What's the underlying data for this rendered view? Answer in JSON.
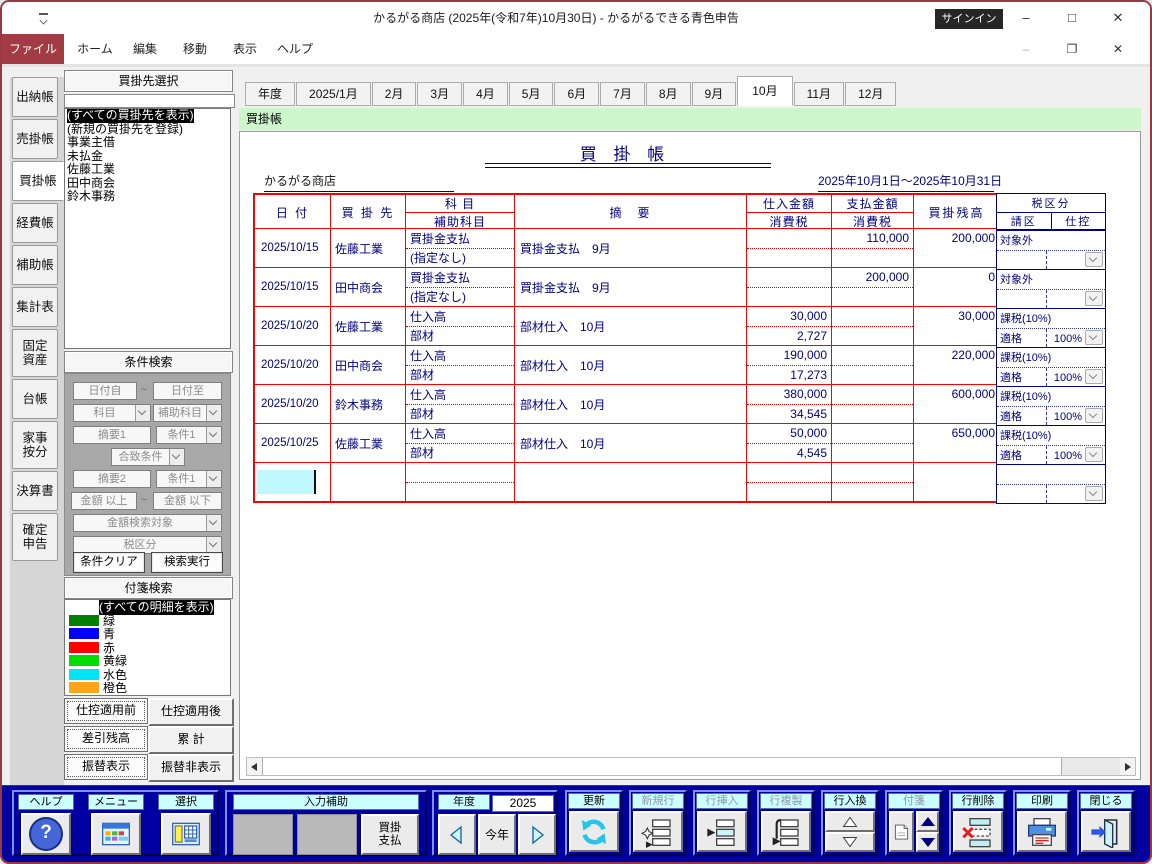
{
  "window": {
    "title": "かるがる商店 (2025年(令和7年)10月30日)  -  かるがるできる青色申告",
    "signin_label": "サインイン",
    "controls": {
      "minimize": "–",
      "maximize": "□",
      "close": "✕"
    },
    "mdi_controls": {
      "minimize": "–",
      "restore": "❐",
      "close": "✕"
    }
  },
  "menubar": {
    "items": [
      {
        "label": "ファイル",
        "selected": true
      },
      {
        "label": "ホーム"
      },
      {
        "label": "編集"
      },
      {
        "label": "移動"
      },
      {
        "label": "表示"
      },
      {
        "label": "ヘルプ"
      }
    ]
  },
  "sidebar": {
    "tabs": [
      {
        "label": "出納帳"
      },
      {
        "label": "売掛帳"
      },
      {
        "label": "買掛帳",
        "selected": true
      },
      {
        "label": "経費帳"
      },
      {
        "label": "補助帳"
      },
      {
        "label": "集計表"
      },
      {
        "label": "固定\n資産",
        "tall": true
      },
      {
        "label": "台帳"
      },
      {
        "label": "家事\n按分",
        "tall": true
      },
      {
        "label": "決算書"
      },
      {
        "label": "確定\n申告",
        "tall": true
      }
    ]
  },
  "partner_panel": {
    "header": "買掛先選択",
    "filter_value": "",
    "items": [
      {
        "label": "(すべての買掛先を表示)",
        "selected": true
      },
      {
        "label": "(新規の買掛先を登録)"
      },
      {
        "label": "事業主借"
      },
      {
        "label": "未払金"
      },
      {
        "label": "佐藤工業"
      },
      {
        "label": "田中商会"
      },
      {
        "label": "鈴木事務"
      }
    ]
  },
  "condition_search": {
    "header": "条件検索",
    "date_from": "日付自",
    "date_to": "日付至",
    "tilde": "~",
    "account": "科目",
    "sub_account": "補助科目",
    "memo1": "摘要1",
    "cond1": "条件1",
    "match": "合致条件",
    "memo2": "摘要2",
    "cond2": "条件1",
    "amount_min": "金額 以上",
    "amount_max": "金額 以下",
    "amount_target": "金額検索対象",
    "tax_division": "税区分",
    "clear_button": "条件クリア",
    "exec_button": "検索実行"
  },
  "fusen_search": {
    "header": "付箋検索",
    "items": [
      {
        "label": "(すべての明細を表示)",
        "selected": true
      },
      {
        "label": "緑",
        "hex": "#008000"
      },
      {
        "label": "青",
        "hex": "#0000FF"
      },
      {
        "label": "赤",
        "hex": "#FF0000"
      },
      {
        "label": "黄緑",
        "hex": "#00DD00"
      },
      {
        "label": "水色",
        "hex": "#00E4F6"
      },
      {
        "label": "橙色",
        "hex": "#FFA41C"
      }
    ]
  },
  "view_toggles": {
    "buttons": [
      {
        "label": "仕控適用前",
        "active": true
      },
      {
        "label": "仕控適用後"
      },
      {
        "label": "差引残高",
        "active": true
      },
      {
        "label": "累 計"
      },
      {
        "label": "振替表示",
        "active": true
      },
      {
        "label": "振替非表示"
      }
    ]
  },
  "month_tabs": {
    "items": [
      {
        "label": "年度"
      },
      {
        "label": "2025/1月"
      },
      {
        "label": "2月"
      },
      {
        "label": "3月"
      },
      {
        "label": "4月"
      },
      {
        "label": "5月"
      },
      {
        "label": "6月"
      },
      {
        "label": "7月"
      },
      {
        "label": "8月"
      },
      {
        "label": "9月"
      },
      {
        "label": "10月",
        "selected": true
      },
      {
        "label": "11月"
      },
      {
        "label": "12月"
      }
    ]
  },
  "banner": {
    "label": "買掛帳"
  },
  "ledger": {
    "title": "買 掛 帳",
    "company": "かるがる商店",
    "period": "2025年10月1日～2025年10月31日",
    "headers": {
      "date": "日 付",
      "partner": "買 掛 先",
      "account": "科 目",
      "sub_account": "補助科目",
      "summary": "摘　要",
      "purchase": "仕入金額",
      "purchase_tax": "消費税",
      "payment": "支払金額",
      "payment_tax": "消費税",
      "balance": "買掛残高",
      "tax_division": "税区分",
      "tax_class": "請区",
      "tax_deduction": "仕控"
    },
    "rows": [
      {
        "date": "2025/10/15",
        "partner": "佐藤工業",
        "account": "買掛金支払",
        "sub_account": "(指定なし)",
        "summary": "買掛金支払　9月",
        "purchase": "",
        "purchase_tax": "",
        "payment": "110,000",
        "payment_tax": "",
        "balance": "200,000",
        "tax_class": "対象外",
        "qualification": "",
        "rate": ""
      },
      {
        "date": "2025/10/15",
        "partner": "田中商会",
        "account": "買掛金支払",
        "sub_account": "(指定なし)",
        "summary": "買掛金支払　9月",
        "purchase": "",
        "purchase_tax": "",
        "payment": "200,000",
        "payment_tax": "",
        "balance": "0",
        "tax_class": "対象外",
        "qualification": "",
        "rate": ""
      },
      {
        "date": "2025/10/20",
        "partner": "佐藤工業",
        "account": "仕入高",
        "sub_account": "部材",
        "summary": "部材仕入　10月",
        "purchase": "30,000",
        "purchase_tax": "2,727",
        "payment": "",
        "payment_tax": "",
        "balance": "30,000",
        "tax_class": "課税(10%)",
        "qualification": "適格",
        "rate": "100%"
      },
      {
        "date": "2025/10/20",
        "partner": "田中商会",
        "account": "仕入高",
        "sub_account": "部材",
        "summary": "部材仕入　10月",
        "purchase": "190,000",
        "purchase_tax": "17,273",
        "payment": "",
        "payment_tax": "",
        "balance": "220,000",
        "tax_class": "課税(10%)",
        "qualification": "適格",
        "rate": "100%"
      },
      {
        "date": "2025/10/20",
        "partner": "鈴木事務",
        "account": "仕入高",
        "sub_account": "部材",
        "summary": "部材仕入　10月",
        "purchase": "380,000",
        "purchase_tax": "34,545",
        "payment": "",
        "payment_tax": "",
        "balance": "600,000",
        "tax_class": "課税(10%)",
        "qualification": "適格",
        "rate": "100%"
      },
      {
        "date": "2025/10/25",
        "partner": "佐藤工業",
        "account": "仕入高",
        "sub_account": "部材",
        "summary": "部材仕入　10月",
        "purchase": "50,000",
        "purchase_tax": "4,545",
        "payment": "",
        "payment_tax": "",
        "balance": "650,000",
        "tax_class": "課税(10%)",
        "qualification": "適格",
        "rate": "100%"
      },
      {
        "date": "",
        "partner": "",
        "account": "",
        "sub_account": "",
        "summary": "",
        "purchase": "",
        "purchase_tax": "",
        "payment": "",
        "payment_tax": "",
        "balance": "",
        "tax_class": "",
        "qualification": "",
        "rate": "",
        "editing": true
      }
    ]
  },
  "toolbar": {
    "help": {
      "label": "ヘルプ",
      "icon": "help-icon",
      "glyph": "?"
    },
    "menu": {
      "label": "メニュー",
      "icon": "menu-icon"
    },
    "select": {
      "label": "選択",
      "icon": "select-icon"
    },
    "input_assist": {
      "label": "入力補助",
      "button": "買掛\n支払"
    },
    "year": {
      "label": "年度",
      "value": "2025",
      "this_year": "今年"
    },
    "commands_a": [
      {
        "label": "更新",
        "icon": "refresh-icon"
      },
      {
        "label": "新規行",
        "icon": "new-row-icon",
        "disabled": true
      },
      {
        "label": "行挿入",
        "icon": "insert-row-icon",
        "disabled": true
      },
      {
        "label": "行複製",
        "icon": "duplicate-row-icon",
        "disabled": true
      }
    ],
    "swap": {
      "label": "行入換"
    },
    "fusen": {
      "label": "付箋",
      "icon": "fusen-icon",
      "disabled": true
    },
    "commands_b": [
      {
        "label": "行削除",
        "icon": "delete-row-icon"
      },
      {
        "label": "印刷",
        "icon": "print-icon"
      },
      {
        "label": "閉じる",
        "icon": "close-door-icon"
      }
    ]
  },
  "colors": {
    "accent_red": "#A23B44",
    "window_border": "#97393E",
    "navy_text": "#000080",
    "grid_red": "#FF0000",
    "toolbar_blue": "#0000A0",
    "label_cyan": "#CCFFFF",
    "banner_green": "#CDF6CD",
    "edit_highlight": "#BFF8FF"
  }
}
